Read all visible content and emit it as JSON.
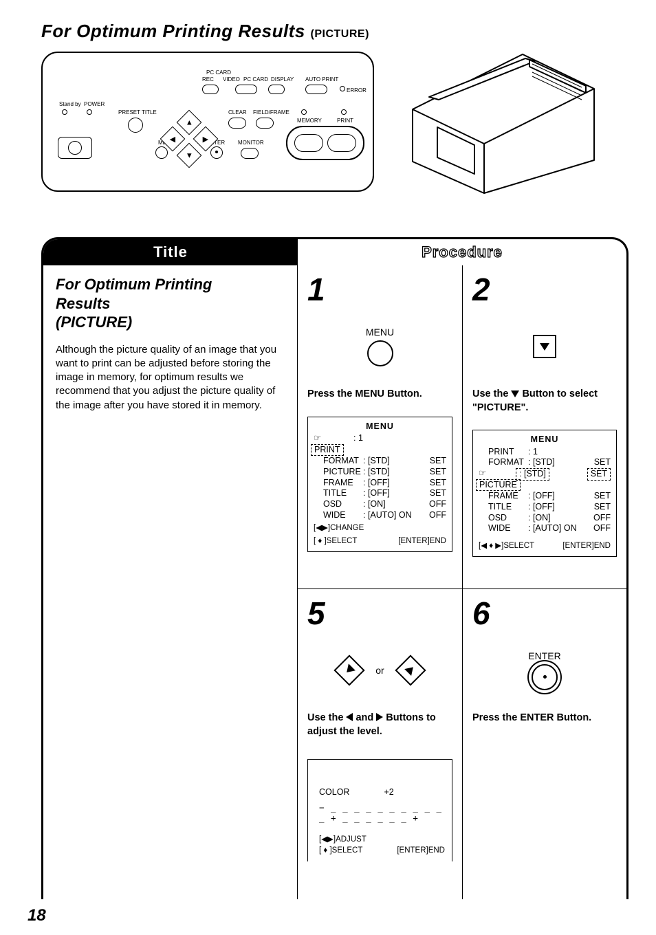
{
  "page_number": "18",
  "title": {
    "main": "For Optimum Printing Results",
    "sub": "(PICTURE)"
  },
  "panel": {
    "standby": "Stand by",
    "power": "POWER",
    "preset_title": "PRESET TITLE",
    "menu": "MENU",
    "enter": "ENTER",
    "clear": "CLEAR",
    "field_frame": "FIELD/FRAME",
    "monitor": "MONITOR",
    "pc_card": "PC CARD",
    "rec": "REC",
    "video": "VIDEO",
    "pc_card2": "PC CARD",
    "display": "DISPLAY",
    "auto_print": "AUTO PRINT",
    "error": "ERROR",
    "memory": "MEMORY",
    "print": "PRINT"
  },
  "headers": {
    "title": "Title",
    "procedure": "Procedure"
  },
  "left": {
    "heading": "For Optimum Printing Results\n(PICTURE)",
    "heading_l1": "For Optimum Printing",
    "heading_l2": "Results",
    "heading_l3": "(PICTURE)",
    "body": "Although the picture quality of an image that you want to print can be adjusted before storing the image in memory, for optimum results we recommend that you adjust the picture quality of the image after you have stored it in memory."
  },
  "steps": {
    "s1": {
      "num": "1",
      "ctrl_label": "MENU",
      "instruction": "Press the MENU Button.",
      "menu": {
        "title": "MENU",
        "pointer_on": "PRINT",
        "rows": [
          {
            "k": "PRINT",
            "v": ": 1",
            "r": ""
          },
          {
            "k": "FORMAT",
            "v": ": [STD]",
            "r": "SET"
          },
          {
            "k": "PICTURE",
            "v": ": [STD]",
            "r": "SET"
          },
          {
            "k": "FRAME",
            "v": ": [OFF]",
            "r": "SET"
          },
          {
            "k": "TITLE",
            "v": ": [OFF]",
            "r": "SET"
          },
          {
            "k": "OSD",
            "v": ": [ON]",
            "r": "OFF"
          },
          {
            "k": "WIDE",
            "v": ": [AUTO]  ON",
            "r": "OFF"
          }
        ],
        "foot1": "[◀▶]CHANGE",
        "foot2": "[ ♦ ]SELECT",
        "foot2r": "[ENTER]END"
      }
    },
    "s2": {
      "num": "2",
      "instruction_pre": "Use the ",
      "instruction_post": " Button to select \"PICTURE\".",
      "menu": {
        "title": "MENU",
        "pointer_on": "PICTURE",
        "rows": [
          {
            "k": "PRINT",
            "v": ": 1",
            "r": ""
          },
          {
            "k": "FORMAT",
            "v": ": [STD]",
            "r": "SET"
          },
          {
            "k": "PICTURE",
            "v": ": [STD]",
            "r": "SET"
          },
          {
            "k": "FRAME",
            "v": ": [OFF]",
            "r": "SET"
          },
          {
            "k": "TITLE",
            "v": ": [OFF]",
            "r": "SET"
          },
          {
            "k": "OSD",
            "v": ": [ON]",
            "r": "OFF"
          },
          {
            "k": "WIDE",
            "v": ": [AUTO]  ON",
            "r": "OFF"
          }
        ],
        "foot2": "[◀ ♦ ▶]SELECT",
        "foot2r": "[ENTER]END"
      }
    },
    "s5": {
      "num": "5",
      "or": "or",
      "instruction_pre": "Use the ",
      "instruction_mid": " and ",
      "instruction_post": " Buttons to adjust the level.",
      "color": {
        "label": "COLOR",
        "value": "+2",
        "scale": "− _ _ _ _ _ _ _ _ _ _ _ + _ _ _ _ _ _  +",
        "foot1": "[◀▶]ADJUST",
        "foot2": "[ ♦ ]SELECT",
        "foot2r": "[ENTER]END"
      }
    },
    "s6": {
      "num": "6",
      "ctrl_label": "ENTER",
      "instruction": "Press the ENTER Button."
    }
  }
}
